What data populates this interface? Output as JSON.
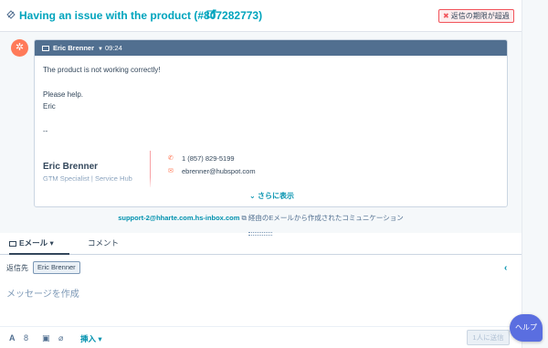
{
  "header": {
    "title": "Having an issue with the product (#807282773)",
    "thread_icon": "ticket-icon",
    "open_icon": "external-link-icon",
    "badge": "返信の期限が超過",
    "badge_icon": "alert-icon"
  },
  "message": {
    "sender": "Eric Brenner",
    "time": "09:24",
    "avatar_icon": "hubspot-sprocket-icon",
    "body": [
      "The product is not working correctly!",
      "Please help.",
      "Eric",
      "--"
    ],
    "signature": {
      "name": "Eric Brenner",
      "role": "GTM Specialist | Service Hub",
      "phone": "1 (857) 829-5199",
      "email": "ebrenner@hubspot.com"
    },
    "show_more": "さらに表示"
  },
  "via": {
    "email": "support-2@hharte.com.hs-inbox.com",
    "text": "経由のEメールから作成されたコミュニケーション"
  },
  "composer": {
    "tabs": [
      "Eメール",
      "コメント"
    ],
    "to_label": "返信先",
    "recipient": "Eric Brenner",
    "placeholder": "メッセージを作成",
    "insert_label": "挿入",
    "send_label": "1人に送信"
  },
  "help": {
    "label": "ヘルプ"
  },
  "colors": {
    "accent": "#00a4bd",
    "link": "#0091ae",
    "alert": "#f2545b",
    "brand": "#ff7a59",
    "header_bg": "#516f90"
  }
}
